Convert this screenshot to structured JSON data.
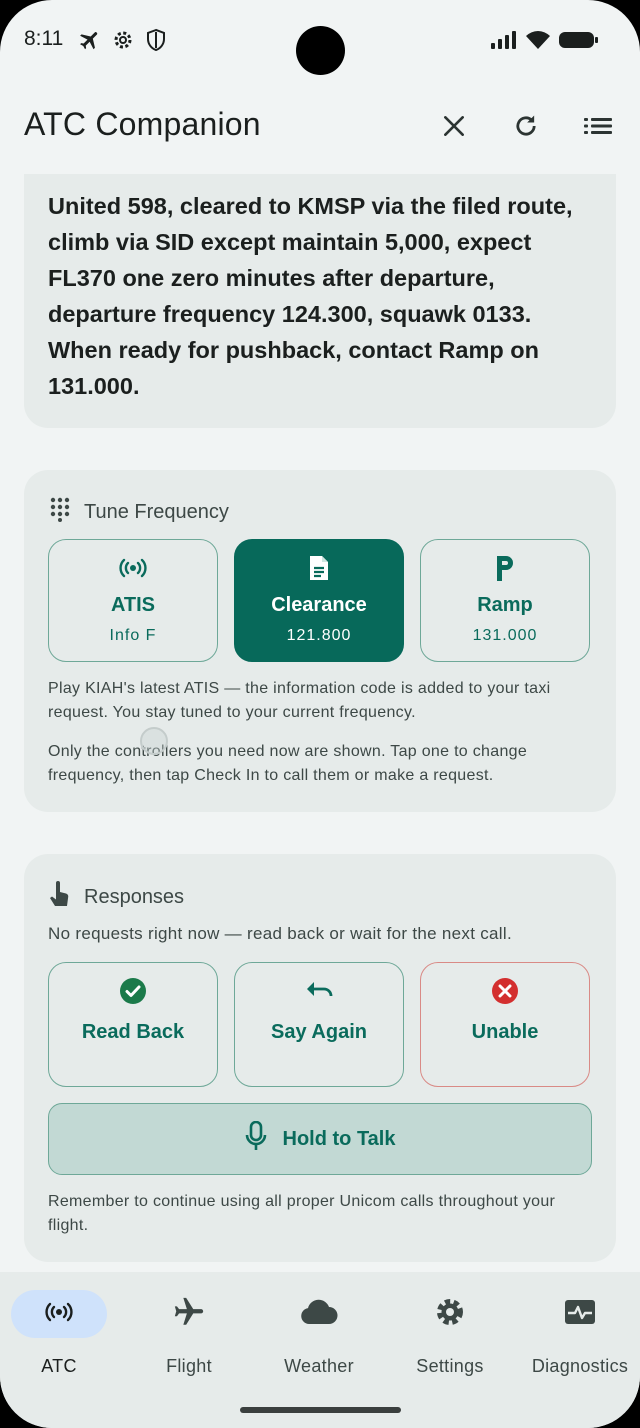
{
  "status_bar": {
    "time": "8:11",
    "icons": [
      "airplane-mode-icon",
      "settings-gear-icon",
      "shield-icon"
    ],
    "right_icons": [
      "signal-icon",
      "wifi-icon",
      "battery-icon"
    ]
  },
  "app_bar": {
    "title": "ATC Companion",
    "actions": [
      "close-icon",
      "refresh-icon",
      "list-icon"
    ]
  },
  "clearance": {
    "text": "United 598, cleared to KMSP via the filed route, climb via SID except maintain 5,000, expect FL370 one zero minutes after departure, departure frequency 124.300, squawk 0133. When ready for pushback, contact Ramp on 131.000."
  },
  "tune": {
    "header": "Tune Frequency",
    "chips": [
      {
        "label": "ATIS",
        "sub": "Info F",
        "icon": "broadcast-icon",
        "active": false
      },
      {
        "label": "Clearance",
        "sub": "121.800",
        "icon": "document-icon",
        "active": true
      },
      {
        "label": "Ramp",
        "sub": "131.000",
        "icon": "parking-icon",
        "active": false
      }
    ],
    "note1": "Play KIAH's latest ATIS — the information code is added to your taxi request. You stay tuned to your current frequency.",
    "note2": "Only the controllers you need now are shown. Tap one to change frequency, then tap Check In to call them or make a request."
  },
  "responses": {
    "header": "Responses",
    "subtitle": "No requests right now — read back or wait for the next call.",
    "buttons": [
      {
        "label": "Read Back",
        "icon": "check-circle-icon"
      },
      {
        "label": "Say Again",
        "icon": "undo-icon"
      },
      {
        "label": "Unable",
        "icon": "cancel-icon"
      }
    ],
    "ptt_label": "Hold to Talk",
    "reminder": "Remember to continue using all proper Unicom calls throughout your flight."
  },
  "nav": {
    "items": [
      {
        "label": "ATC",
        "icon": "broadcast-icon",
        "active": true
      },
      {
        "label": "Flight",
        "icon": "airplane-icon",
        "active": false
      },
      {
        "label": "Weather",
        "icon": "cloud-icon",
        "active": false
      },
      {
        "label": "Settings",
        "icon": "gear-icon",
        "active": false
      },
      {
        "label": "Diagnostics",
        "icon": "monitor-heart-icon",
        "active": false
      }
    ]
  },
  "colors": {
    "accent": "#07695a",
    "accent_text": "#0a6b5c",
    "danger": "#d32f2f",
    "success": "#1b7a4a",
    "nav_active": "#cfe2fb"
  }
}
